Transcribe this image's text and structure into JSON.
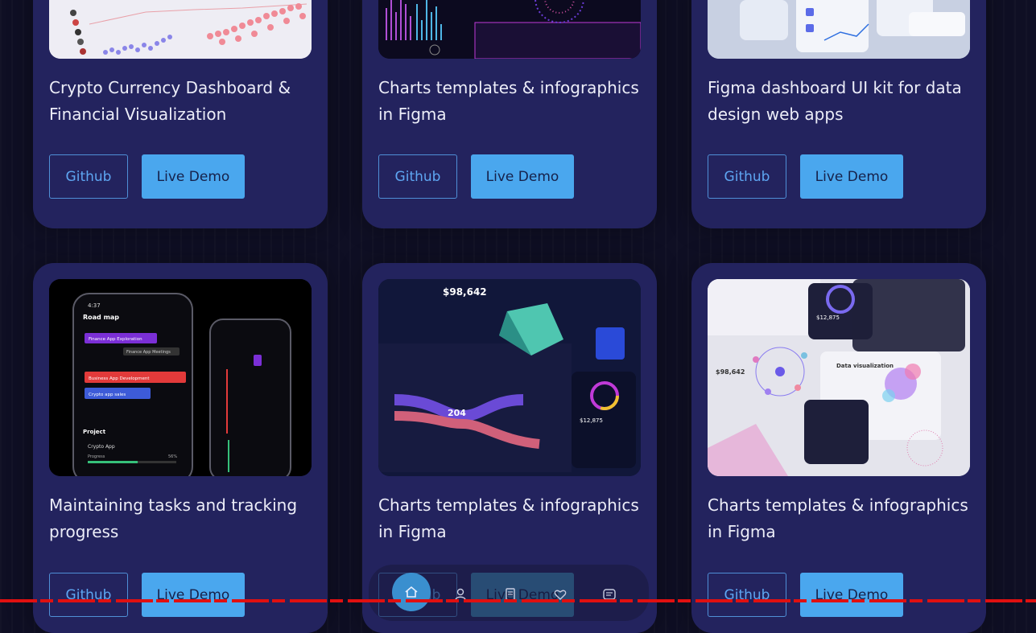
{
  "buttons": {
    "github": "Github",
    "demo": "Live Demo"
  },
  "cards": [
    {
      "title": "Crypto Currency Dashboard & Financial Visualization"
    },
    {
      "title": "Charts templates & infographics in Figma"
    },
    {
      "title": "Figma dashboard UI kit for data design web apps"
    },
    {
      "title": "Maintaining tasks and tracking progress"
    },
    {
      "title": "Charts templates & infographics in Figma"
    },
    {
      "title": "Charts templates & infographics in Figma"
    }
  ],
  "thumb_text": {
    "roadmap": "Road map",
    "time": "4:37",
    "finance_exploration": "Finance App Exploration",
    "finance_meetings": "Finance App Meetings",
    "business_dev": "Business App Development",
    "crypto_sales": "Crypto app sales",
    "project": "Project",
    "crypto_app": "Crypto App",
    "progress": "Progress",
    "progress_pct": "56%",
    "big_value_1": "$98,642",
    "sankey_value": "204",
    "total_earning": "$12,875",
    "big_value_2": "$98,642",
    "data_visualization": "Data visualization",
    "total_2": "$12,875"
  },
  "colors": {
    "accent": "#4aa7ee",
    "card": "#23235e",
    "background": "#0f0f24"
  },
  "nav": {
    "items": [
      "home-icon",
      "user-icon",
      "document-icon",
      "heart-icon",
      "message-icon"
    ]
  }
}
